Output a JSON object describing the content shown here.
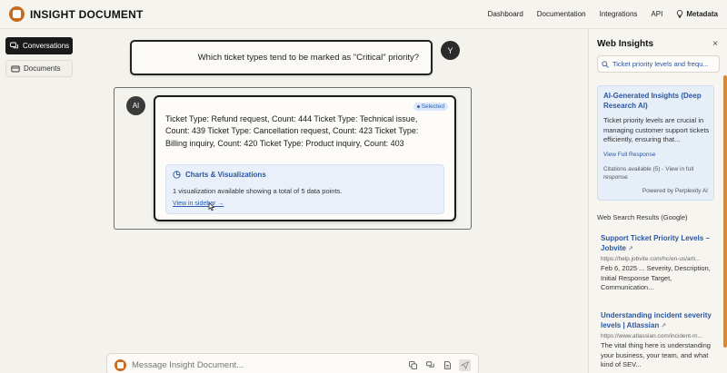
{
  "header": {
    "brand": "INSIGHT DOCUMENT",
    "nav": [
      "Dashboard",
      "Documentation",
      "Integrations",
      "API"
    ],
    "metadata_label": "Metadata"
  },
  "sidebar": {
    "items": [
      {
        "label": "Conversations",
        "icon": "chat-bubbles-icon",
        "active": true
      },
      {
        "label": "Documents",
        "icon": "document-icon",
        "active": false
      }
    ]
  },
  "chat": {
    "user_avatar": "Y",
    "question": "Which ticket types tend to be marked as \"Critical\" priority?",
    "ai_avatar": "AI",
    "selected_badge": "Selected",
    "answer": "Ticket Type: Refund request, Count: 444 Ticket Type: Technical issue, Count: 439 Ticket Type: Cancellation request, Count: 423 Ticket Type: Billing inquiry, Count: 420 Ticket Type: Product inquiry, Count: 403",
    "viz": {
      "title": "Charts & Visualizations",
      "description": "1 visualization available showing a total of 5 data points.",
      "link": "View in sidebar →"
    }
  },
  "composer": {
    "placeholder": "Message Insight Document..."
  },
  "web_insights": {
    "title": "Web Insights",
    "close": "×",
    "search_value": "Ticket priority levels and frequ...",
    "ai_card": {
      "title": "AI-Generated Insights (Deep Research AI)",
      "text": "Ticket priority levels are crucial in managing customer support tickets efficiently, ensuring that...",
      "link": "View Full Response",
      "citations": "Citations available (5) - View in full response",
      "powered": "Powered by Perplexity AI"
    },
    "results_label": "Web Search Results (Google)",
    "results": [
      {
        "title": "Support Ticket Priority Levels – Jobvite",
        "url": "https://help.jobvite.com/hc/en-us/arti...",
        "snippet": "Feb 6, 2025 ... Severity, Description, Initial Response Target, Communication..."
      },
      {
        "title": "Understanding incident severity levels | Atlassian",
        "url": "https://www.atlassian.com/incident-m...",
        "snippet": "The vital thing here is understanding your business, your team, and what kind of SEV..."
      }
    ]
  },
  "colors": {
    "accent_orange": "#c96a1d",
    "link_blue": "#2b56a0",
    "viz_bg": "#e9f0f9"
  }
}
